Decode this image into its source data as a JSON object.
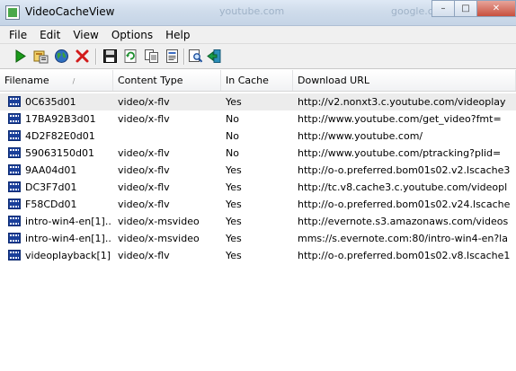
{
  "window": {
    "title": "VideoCacheView",
    "ghost_tabs": [
      "youtube.com",
      "google.com"
    ],
    "controls": [
      "–",
      "□",
      "✕"
    ]
  },
  "menu": [
    "File",
    "Edit",
    "View",
    "Options",
    "Help"
  ],
  "toolbar_icons": [
    "play-icon",
    "save-selected-icon",
    "globe-icon",
    "delete-icon",
    "save-icon",
    "refresh-icon",
    "copy-icon",
    "properties-icon",
    "find-icon",
    "exit-icon"
  ],
  "columns": [
    "Filename",
    "Content Type",
    "In Cache",
    "Download URL"
  ],
  "sort_indicator": "/",
  "rows": [
    {
      "filename": "0C635d01",
      "content_type": "video/x-flv",
      "in_cache": "Yes",
      "url": "http://v2.nonxt3.c.youtube.com/videoplay"
    },
    {
      "filename": "17BA92B3d01",
      "content_type": "video/x-flv",
      "in_cache": "No",
      "url": "http://www.youtube.com/get_video?fmt="
    },
    {
      "filename": "4D2F82E0d01",
      "content_type": "",
      "in_cache": "No",
      "url": "http://www.youtube.com/"
    },
    {
      "filename": "59063150d01",
      "content_type": "video/x-flv",
      "in_cache": "No",
      "url": "http://www.youtube.com/ptracking?plid="
    },
    {
      "filename": "9AA04d01",
      "content_type": "video/x-flv",
      "in_cache": "Yes",
      "url": "http://o-o.preferred.bom01s02.v2.lscache3"
    },
    {
      "filename": "DC3F7d01",
      "content_type": "video/x-flv",
      "in_cache": "Yes",
      "url": "http://tc.v8.cache3.c.youtube.com/videopl"
    },
    {
      "filename": "F58CDd01",
      "content_type": "video/x-flv",
      "in_cache": "Yes",
      "url": "http://o-o.preferred.bom01s02.v24.lscache"
    },
    {
      "filename": "intro-win4-en[1]....",
      "content_type": "video/x-msvideo",
      "in_cache": "Yes",
      "url": "http://evernote.s3.amazonaws.com/videos"
    },
    {
      "filename": "intro-win4-en[1]....",
      "content_type": "video/x-msvideo",
      "in_cache": "Yes",
      "url": "mms://s.evernote.com:80/intro-win4-en?la"
    },
    {
      "filename": "videoplayback[1]",
      "content_type": "video/x-flv",
      "in_cache": "Yes",
      "url": "http://o-o.preferred.bom01s02.v8.lscache1"
    }
  ]
}
